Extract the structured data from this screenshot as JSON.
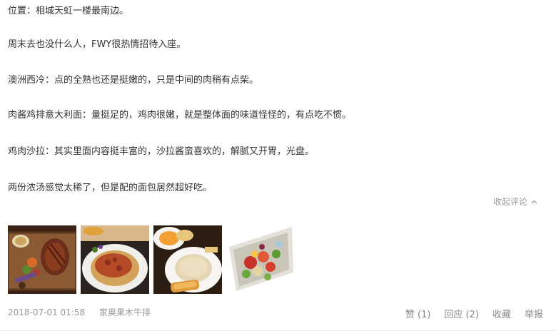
{
  "review": {
    "paragraphs": [
      "位置：相城天虹一楼最南边。",
      "周末去也没什么人，FWY很热情招待入座。",
      "澳洲西冷：点的全熟也还是挺嫩的，只是中间的肉稍有点柴。",
      "肉酱鸡排意大利面：量挺足的，鸡肉很嫩，就是整体面的味道怪怪的，有点吃不惯。",
      "鸡肉沙拉：其实里面内容挺丰富的，沙拉酱蛮喜欢的，解腻又开胃，光盘。",
      "两份浓汤感觉太稀了，但是配的面包居然超好吃。"
    ],
    "collapse_label": "收起评论",
    "photos": [
      "steak-board-photo",
      "chicken-pasta-photo",
      "soup-and-bread-photo",
      "chicken-salad-photo"
    ],
    "date": "2018-07-01 01:58",
    "shop": "家奥果木牛排",
    "actions": {
      "like": "赞 (1)",
      "reply": "回应 (2)",
      "favorite": "收藏",
      "report": "举报"
    }
  },
  "colors": {
    "text": "#333333",
    "muted": "#999999",
    "action": "#888888"
  }
}
